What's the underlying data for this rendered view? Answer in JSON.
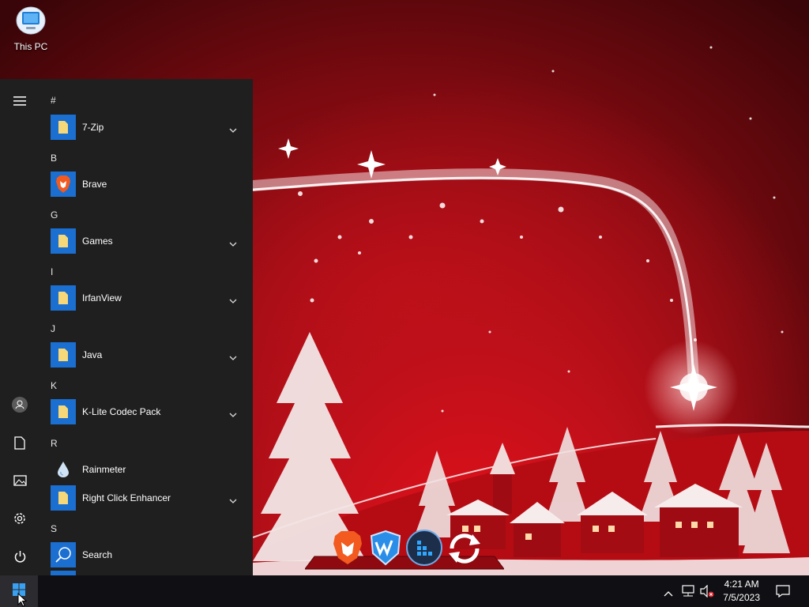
{
  "desktop": {
    "icons": [
      {
        "label": "This PC",
        "icon": "monitor-icon"
      }
    ]
  },
  "start_menu": {
    "rail": [
      "hamburger-menu-icon",
      "user-account-icon",
      "documents-icon",
      "pictures-icon",
      "settings-icon",
      "power-icon"
    ],
    "groups": [
      {
        "letter": "#",
        "apps": [
          {
            "label": "7-Zip",
            "icon": "folder-icon",
            "expandable": true
          }
        ]
      },
      {
        "letter": "B",
        "apps": [
          {
            "label": "Brave",
            "icon": "brave-lion-icon",
            "expandable": false
          }
        ]
      },
      {
        "letter": "G",
        "apps": [
          {
            "label": "Games",
            "icon": "folder-icon",
            "expandable": true
          }
        ]
      },
      {
        "letter": "I",
        "apps": [
          {
            "label": "IrfanView",
            "icon": "folder-icon",
            "expandable": true
          }
        ]
      },
      {
        "letter": "J",
        "apps": [
          {
            "label": "Java",
            "icon": "folder-icon",
            "expandable": true
          }
        ]
      },
      {
        "letter": "K",
        "apps": [
          {
            "label": "K-Lite Codec Pack",
            "icon": "folder-icon",
            "expandable": true
          }
        ]
      },
      {
        "letter": "R",
        "apps": [
          {
            "label": "Rainmeter",
            "icon": "raindrop-icon",
            "expandable": false
          },
          {
            "label": "Right Click Enhancer",
            "icon": "folder-icon",
            "expandable": true
          }
        ]
      },
      {
        "letter": "S",
        "apps": [
          {
            "label": "Search",
            "icon": "search-icon",
            "expandable": false
          }
        ]
      }
    ]
  },
  "dock": {
    "apps": [
      "brave-lion-icon",
      "wise-care-icon",
      "app-grid-icon",
      "sync-refresh-icon"
    ]
  },
  "taskbar": {
    "start_icon": "windows-logo-icon",
    "tray_icons": [
      "chevron-up-icon",
      "network-icon",
      "volume-muted-icon"
    ],
    "time": "4:21 AM",
    "date": "7/5/2023",
    "notification_icon": "action-center-icon"
  },
  "colors": {
    "start_bg": "#1f1f1f",
    "tile_blue": "#1a6fd1",
    "taskbar_bg": "#101014",
    "wallpaper_red": "#c0101a"
  }
}
